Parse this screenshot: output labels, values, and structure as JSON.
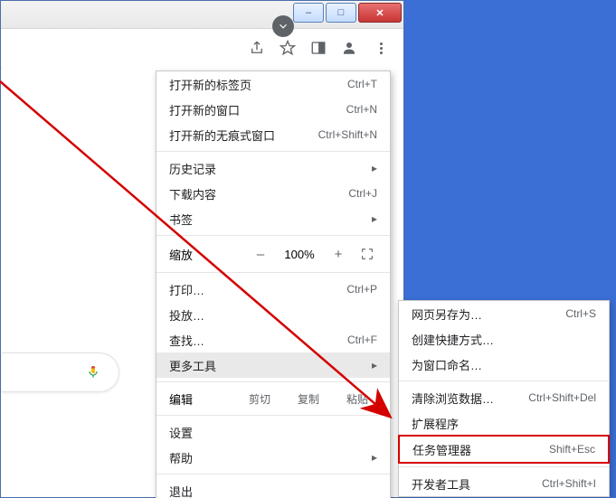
{
  "window_controls": {
    "minimize": "–",
    "maximize": "□",
    "close": "✕"
  },
  "toolbar": {
    "share_icon": "share-icon",
    "star_icon": "star-icon",
    "panel_icon": "side-panel-icon",
    "avatar_icon": "avatar-icon",
    "menu_icon": "kebab-menu-icon",
    "expand_icon": "chevron-down-icon"
  },
  "menu": {
    "new_tab": {
      "label": "打开新的标签页",
      "shortcut": "Ctrl+T"
    },
    "new_window": {
      "label": "打开新的窗口",
      "shortcut": "Ctrl+N"
    },
    "new_incognito": {
      "label": "打开新的无痕式窗口",
      "shortcut": "Ctrl+Shift+N"
    },
    "history": {
      "label": "历史记录"
    },
    "downloads": {
      "label": "下载内容",
      "shortcut": "Ctrl+J"
    },
    "bookmarks": {
      "label": "书签"
    },
    "zoom": {
      "label": "缩放",
      "value": "100%",
      "minus": "–",
      "plus": "+"
    },
    "print": {
      "label": "打印…",
      "shortcut": "Ctrl+P"
    },
    "cast": {
      "label": "投放…"
    },
    "find": {
      "label": "查找…",
      "shortcut": "Ctrl+F"
    },
    "more_tools": {
      "label": "更多工具"
    },
    "edit": {
      "label": "编辑",
      "cut": "剪切",
      "copy": "复制",
      "paste": "粘贴"
    },
    "settings": {
      "label": "设置"
    },
    "help": {
      "label": "帮助"
    },
    "exit": {
      "label": "退出"
    }
  },
  "submenu": {
    "save_page": {
      "label": "网页另存为…",
      "shortcut": "Ctrl+S"
    },
    "shortcut": {
      "label": "创建快捷方式…"
    },
    "name_window": {
      "label": "为窗口命名…"
    },
    "clear_data": {
      "label": "清除浏览数据…",
      "shortcut": "Ctrl+Shift+Del"
    },
    "extensions": {
      "label": "扩展程序"
    },
    "task_mgr": {
      "label": "任务管理器",
      "shortcut": "Shift+Esc"
    },
    "dev_tools": {
      "label": "开发者工具",
      "shortcut": "Ctrl+Shift+I"
    }
  }
}
